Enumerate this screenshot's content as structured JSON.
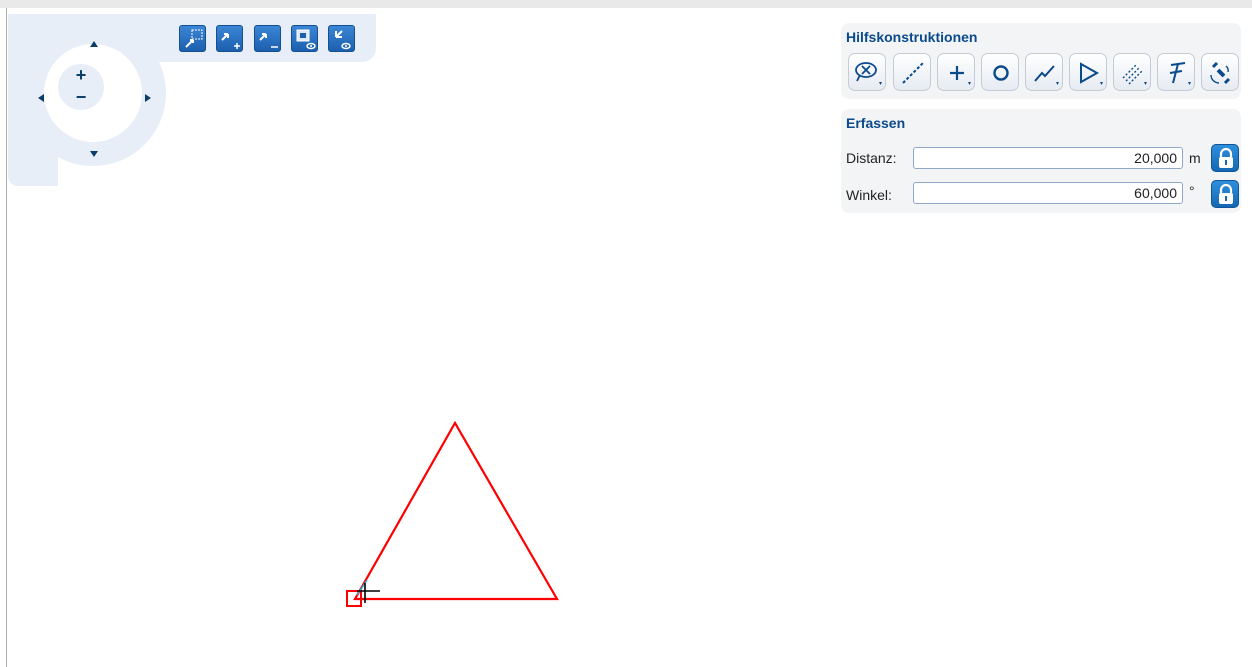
{
  "hilfskonstruktionen": {
    "title": "Hilfskonstruktionen",
    "tools": [
      {
        "icon": "clear-construction-icon"
      },
      {
        "icon": "line-icon"
      },
      {
        "icon": "point-icon"
      },
      {
        "icon": "circle-icon"
      },
      {
        "icon": "polyline-icon"
      },
      {
        "icon": "polygon-icon"
      },
      {
        "icon": "parallel-lines-icon"
      },
      {
        "icon": "perpendicular-icon"
      },
      {
        "icon": "satellite-icon"
      }
    ]
  },
  "erfassen": {
    "title": "Erfassen",
    "distanz": {
      "label": "Distanz:",
      "value": "20,000",
      "unit": "m"
    },
    "winkel": {
      "label": "Winkel:",
      "value": "60,000",
      "unit": "°"
    }
  },
  "navigation": {
    "zoom_in": "+",
    "zoom_out": "−"
  },
  "map_toolbar": [
    {
      "icon": "zoom-to-box-icon"
    },
    {
      "icon": "zoom-in-tool-icon"
    },
    {
      "icon": "zoom-out-tool-icon"
    },
    {
      "icon": "full-extent-view-icon"
    },
    {
      "icon": "previous-view-icon"
    }
  ],
  "colors": {
    "accent": "#0b4a8b",
    "drawing": "#ff0000",
    "button_blue": "#1c5fae"
  }
}
